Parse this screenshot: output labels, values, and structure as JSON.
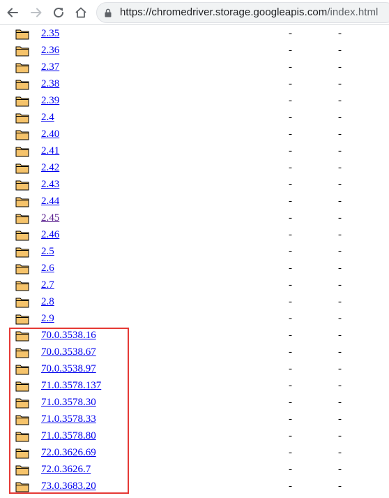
{
  "browser": {
    "url_domain": "https://chromedriver.storage.googleapis.com",
    "url_path": "/index.html",
    "icons": {
      "back": "arrow-left-icon",
      "forward": "arrow-right-icon",
      "reload": "reload-icon",
      "home": "home-icon",
      "lock": "lock-icon"
    }
  },
  "listing": {
    "folder_icon": "folder-icon",
    "rows": [
      {
        "name": "2.35",
        "col2": "-",
        "col3": "-",
        "visited": false
      },
      {
        "name": "2.36",
        "col2": "-",
        "col3": "-",
        "visited": false
      },
      {
        "name": "2.37",
        "col2": "-",
        "col3": "-",
        "visited": false
      },
      {
        "name": "2.38",
        "col2": "-",
        "col3": "-",
        "visited": false
      },
      {
        "name": "2.39",
        "col2": "-",
        "col3": "-",
        "visited": false
      },
      {
        "name": "2.4",
        "col2": "-",
        "col3": "-",
        "visited": false
      },
      {
        "name": "2.40",
        "col2": "-",
        "col3": "-",
        "visited": false
      },
      {
        "name": "2.41",
        "col2": "-",
        "col3": "-",
        "visited": false
      },
      {
        "name": "2.42",
        "col2": "-",
        "col3": "-",
        "visited": false
      },
      {
        "name": "2.43",
        "col2": "-",
        "col3": "-",
        "visited": false
      },
      {
        "name": "2.44",
        "col2": "-",
        "col3": "-",
        "visited": false
      },
      {
        "name": "2.45",
        "col2": "-",
        "col3": "-",
        "visited": true
      },
      {
        "name": "2.46",
        "col2": "-",
        "col3": "-",
        "visited": false
      },
      {
        "name": "2.5",
        "col2": "-",
        "col3": "-",
        "visited": false
      },
      {
        "name": "2.6",
        "col2": "-",
        "col3": "-",
        "visited": false
      },
      {
        "name": "2.7",
        "col2": "-",
        "col3": "-",
        "visited": false
      },
      {
        "name": "2.8",
        "col2": "-",
        "col3": "-",
        "visited": false
      },
      {
        "name": "2.9",
        "col2": "-",
        "col3": "-",
        "visited": false
      },
      {
        "name": "70.0.3538.16",
        "col2": "-",
        "col3": "-",
        "visited": false
      },
      {
        "name": "70.0.3538.67",
        "col2": "-",
        "col3": "-",
        "visited": false
      },
      {
        "name": "70.0.3538.97",
        "col2": "-",
        "col3": "-",
        "visited": false
      },
      {
        "name": "71.0.3578.137",
        "col2": "-",
        "col3": "-",
        "visited": false
      },
      {
        "name": "71.0.3578.30",
        "col2": "-",
        "col3": "-",
        "visited": false
      },
      {
        "name": "71.0.3578.33",
        "col2": "-",
        "col3": "-",
        "visited": false
      },
      {
        "name": "71.0.3578.80",
        "col2": "-",
        "col3": "-",
        "visited": false
      },
      {
        "name": "72.0.3626.69",
        "col2": "-",
        "col3": "-",
        "visited": false
      },
      {
        "name": "72.0.3626.7",
        "col2": "-",
        "col3": "-",
        "visited": false
      },
      {
        "name": "73.0.3683.20",
        "col2": "-",
        "col3": "-",
        "visited": false
      }
    ]
  },
  "colors": {
    "link": "#0000ee",
    "visited_link": "#551a8b",
    "highlight": "#e53935",
    "folder_fill": "#f5c36b"
  }
}
